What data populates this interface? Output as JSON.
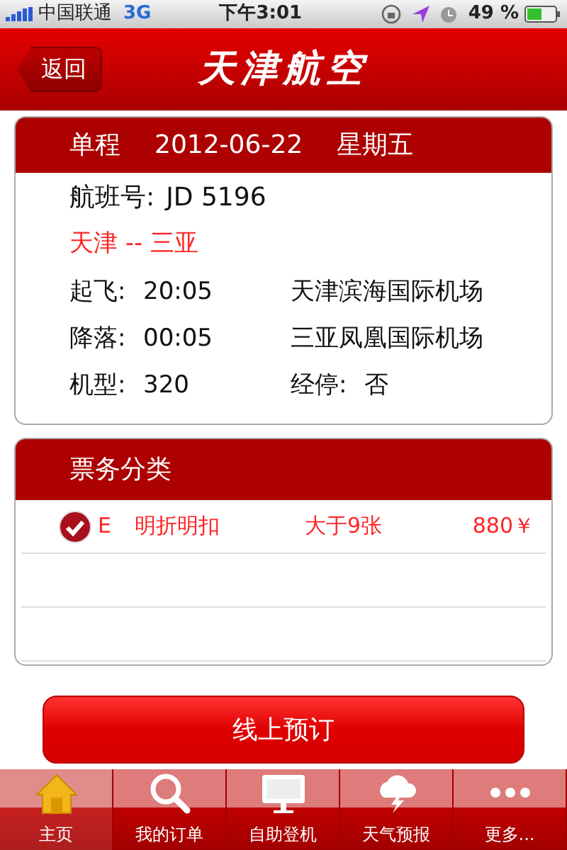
{
  "status_bar": {
    "carrier": "中国联通",
    "network": "3G",
    "time": "下午3:01",
    "battery": "49 %"
  },
  "nav": {
    "back": "返回",
    "title": "天津航空"
  },
  "flight": {
    "trip_type": "单程",
    "date": "2012-06-22",
    "weekday": "星期五",
    "flight_no_label": "航班号:",
    "flight_no": "JD 5196",
    "route": "天津 -- 三亚",
    "details": [
      {
        "label": "起飞:",
        "value": "20:05",
        "extra": "天津滨海国际机场"
      },
      {
        "label": "降落:",
        "value": "00:05",
        "extra": "三亚凤凰国际机场"
      },
      {
        "label": "机型:",
        "value": "320",
        "extra_label": "经停:",
        "extra": "否"
      }
    ]
  },
  "tickets": {
    "title": "票务分类",
    "rows": [
      {
        "selected": true,
        "cabin": "E",
        "fare": "明折明扣",
        "seats": "大于9张",
        "price": "880￥"
      }
    ]
  },
  "book_button": "线上预订",
  "tabs": [
    {
      "kind": "home",
      "label": "主页",
      "selected": true
    },
    {
      "kind": "search",
      "label": "我的订单",
      "selected": false
    },
    {
      "kind": "kiosk",
      "label": "自助登机",
      "selected": false
    },
    {
      "kind": "weather",
      "label": "天气预报",
      "selected": false
    },
    {
      "kind": "more",
      "label": "更多...",
      "selected": false
    }
  ]
}
